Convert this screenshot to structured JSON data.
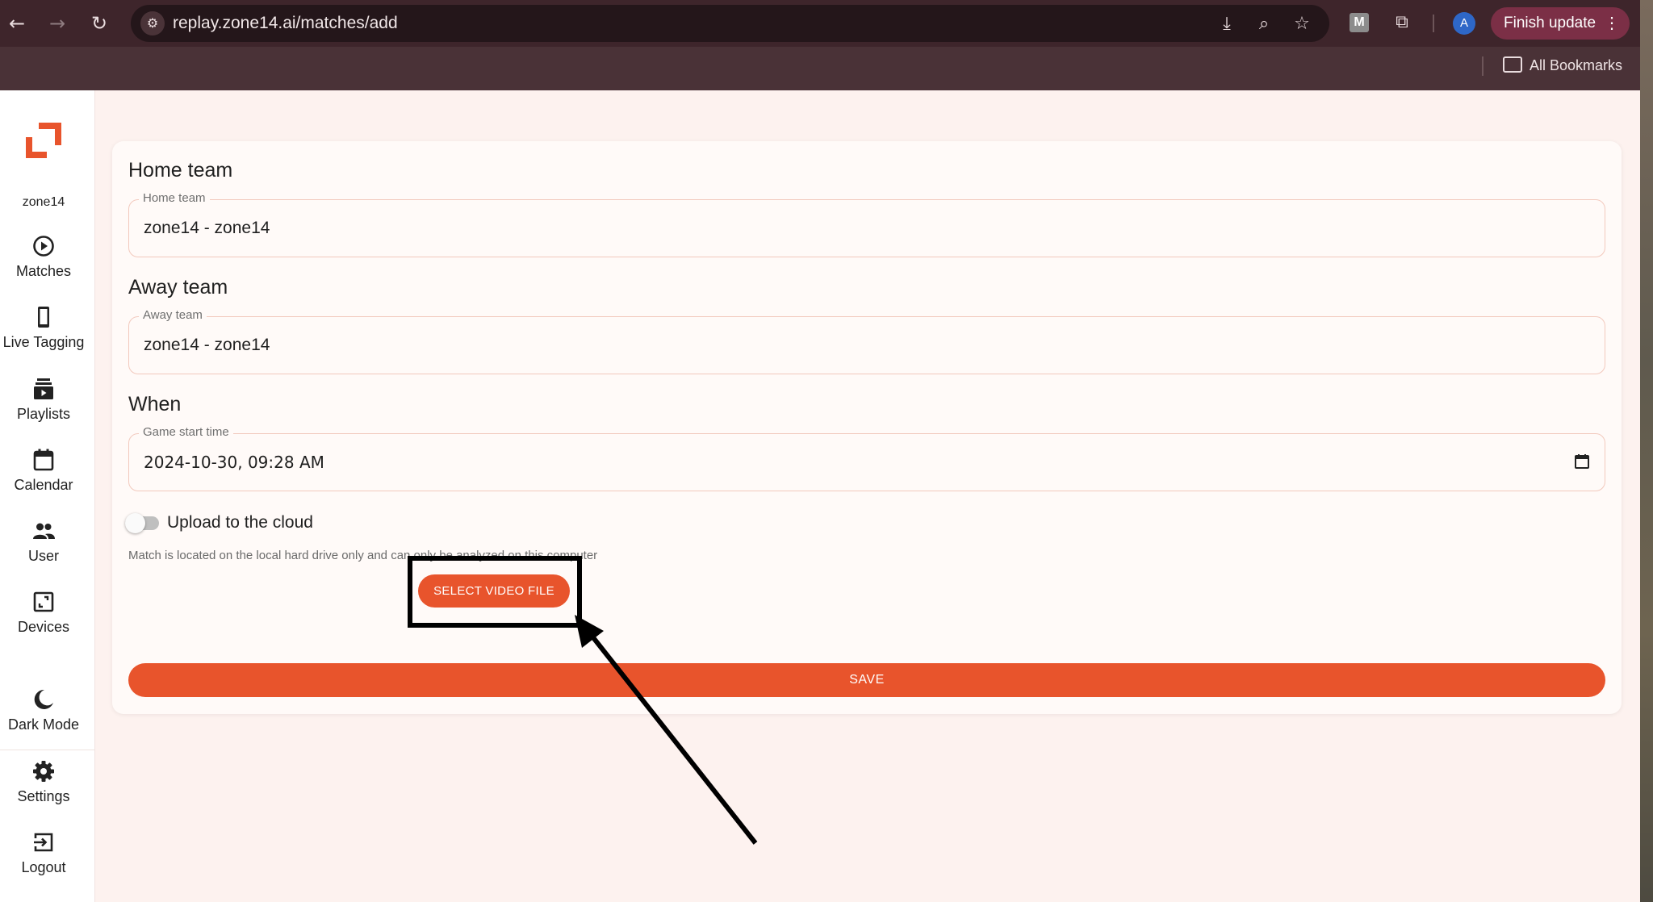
{
  "browser": {
    "url": "replay.zone14.ai/matches/add",
    "extension_label": "M",
    "profile_initial": "A",
    "finish_update": "Finish update",
    "bookmarks_label": "All Bookmarks",
    "icons": [
      "back-icon",
      "forward-icon",
      "reload-icon",
      "site-settings-icon",
      "install-icon",
      "zoom-icon",
      "star-icon",
      "extensions-icon",
      "kebab-icon",
      "folder-icon"
    ]
  },
  "sidebar": {
    "brand": "zone14",
    "items": [
      {
        "label": "Matches",
        "icon": "play-circle-icon"
      },
      {
        "label": "Live Tagging",
        "icon": "phone-icon"
      },
      {
        "label": "Playlists",
        "icon": "playlist-icon"
      },
      {
        "label": "Calendar",
        "icon": "calendar-icon"
      },
      {
        "label": "User",
        "icon": "users-icon"
      },
      {
        "label": "Devices",
        "icon": "devices-icon"
      },
      {
        "label": "Dark Mode",
        "icon": "moon-icon"
      },
      {
        "label": "Settings",
        "icon": "gear-icon"
      },
      {
        "label": "Logout",
        "icon": "logout-icon"
      }
    ]
  },
  "form": {
    "home_title": "Home team",
    "home_label": "Home team",
    "home_value": "zone14 - zone14",
    "away_title": "Away team",
    "away_label": "Away team",
    "away_value": "zone14 - zone14",
    "when_title": "When",
    "when_label": "Game start time",
    "when_value": "2024-10-30, 09:28 AM",
    "upload_label": "Upload to the cloud",
    "upload_enabled": false,
    "helper": "Match is located on the local hard drive only and can only be analyzed on this computer",
    "select_video": "SELECT VIDEO FILE",
    "save": "SAVE"
  },
  "colors": {
    "accent": "#e8542c",
    "chrome_bg": "#3e252b",
    "page_bg": "#fdf2ef",
    "annotation": "#000000"
  }
}
